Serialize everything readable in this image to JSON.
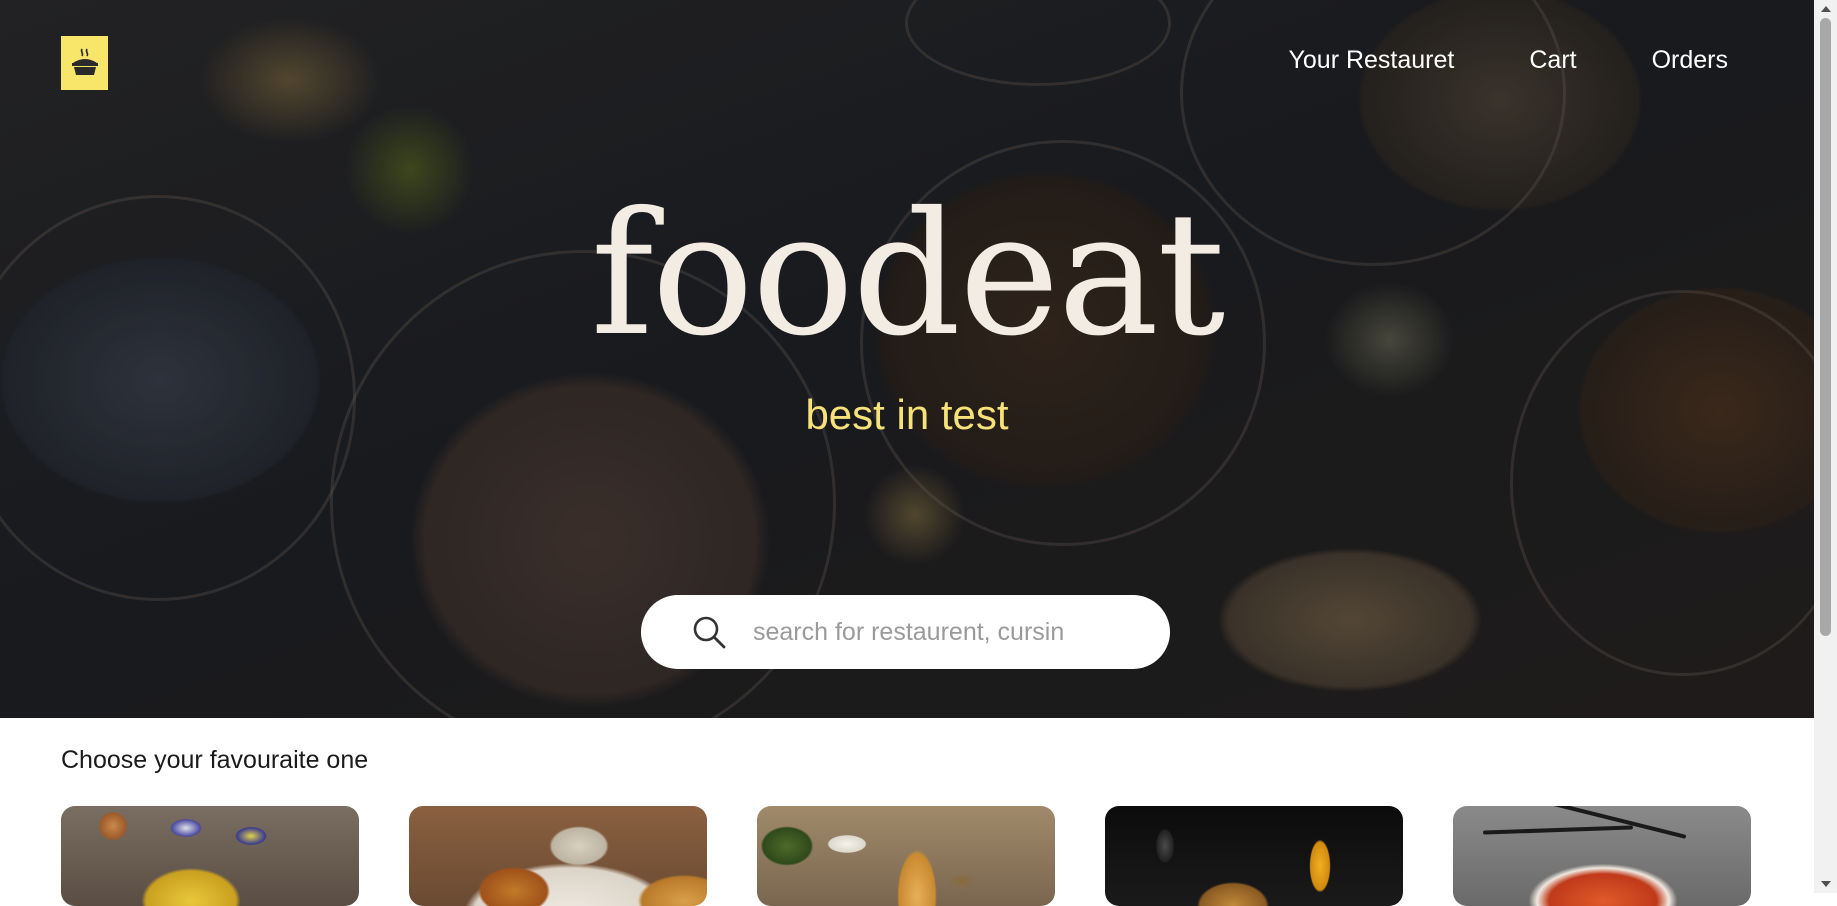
{
  "brand": {
    "logo_icon": "pot-icon",
    "name": "foodeat",
    "tagline": "best in test",
    "accent_color": "#f7e66a"
  },
  "nav": {
    "items": [
      {
        "label": "Your Restauret"
      },
      {
        "label": "Cart"
      },
      {
        "label": "Orders"
      }
    ]
  },
  "search": {
    "icon": "search-icon",
    "placeholder": "search for restaurent, cursin",
    "value": ""
  },
  "section": {
    "title": "Choose your favouraite one",
    "cards": [
      {
        "image": "food-image"
      },
      {
        "image": "food-image"
      },
      {
        "image": "food-image"
      },
      {
        "image": "food-image"
      },
      {
        "image": "food-image"
      }
    ]
  }
}
